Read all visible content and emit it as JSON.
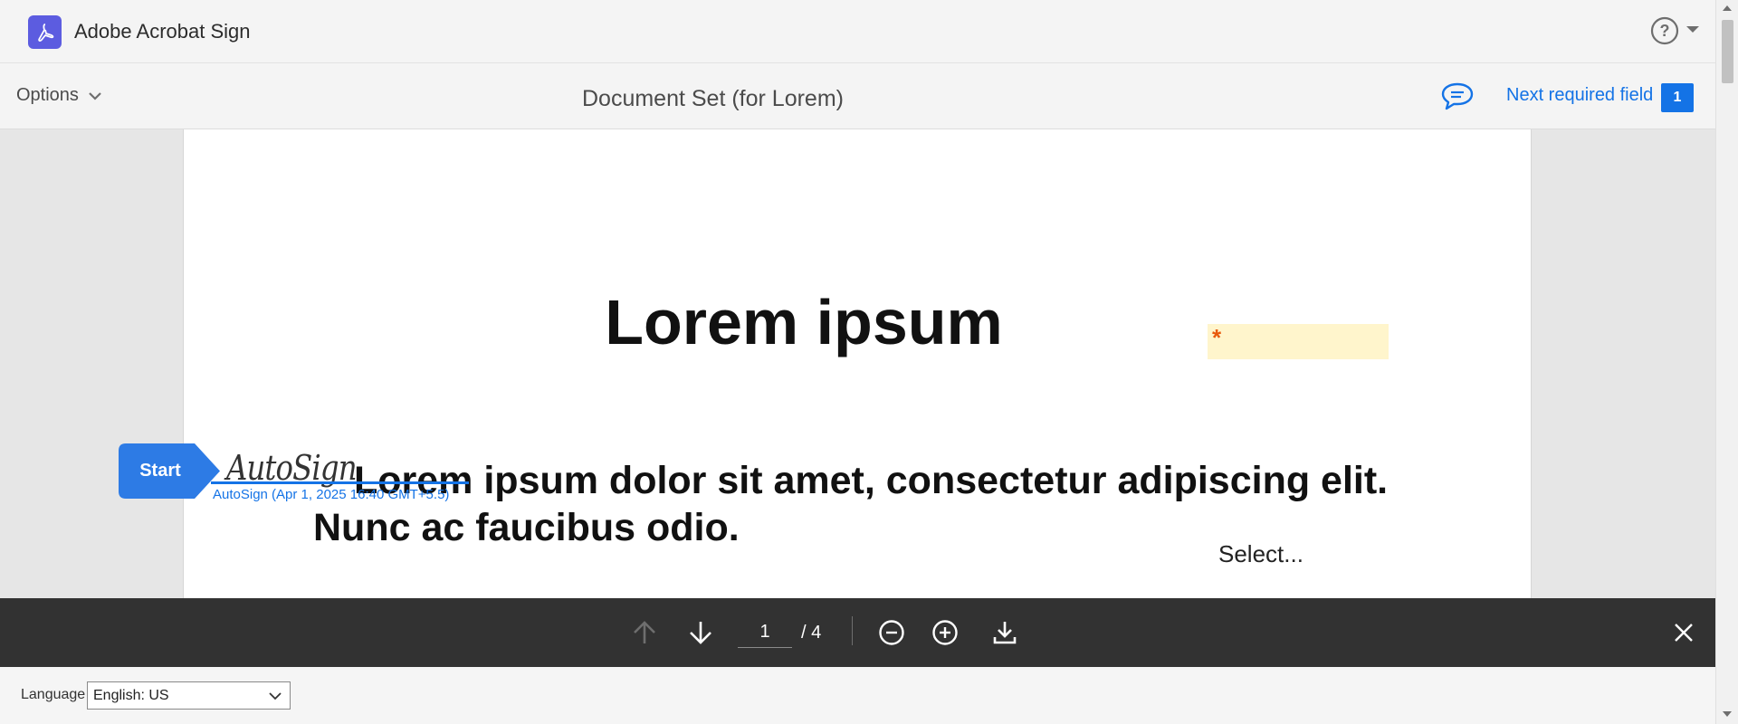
{
  "app": {
    "title": "Adobe Acrobat Sign",
    "brand_color": "#5c5ce0",
    "accent_color": "#1473e6"
  },
  "toolbar": {
    "options_label": "Options",
    "document_title": "Document Set (for Lorem)",
    "next_required_label": "Next required field",
    "next_required_count": "1"
  },
  "document": {
    "heading": "Lorem ipsum",
    "paragraph": "Lorem ipsum dolor sit amet, consectetur adipiscing elit. Nunc ac faucibus odio.",
    "required_marker": "*",
    "select_text": "Select...",
    "signature_script": "AutoSign",
    "signature_caption": "AutoSign (Apr 1, 2025 16:40 GMT+5.5)",
    "start_label": "Start",
    "required_field_color": "#fff5cc"
  },
  "navigation": {
    "current_page": "1",
    "page_total": "/ 4",
    "icons": [
      "arrow-up-icon",
      "arrow-down-icon",
      "zoom-out-icon",
      "zoom-in-icon",
      "download-icon",
      "close-icon"
    ]
  },
  "footer": {
    "language_label": "Language",
    "language_selected": "English: US"
  }
}
